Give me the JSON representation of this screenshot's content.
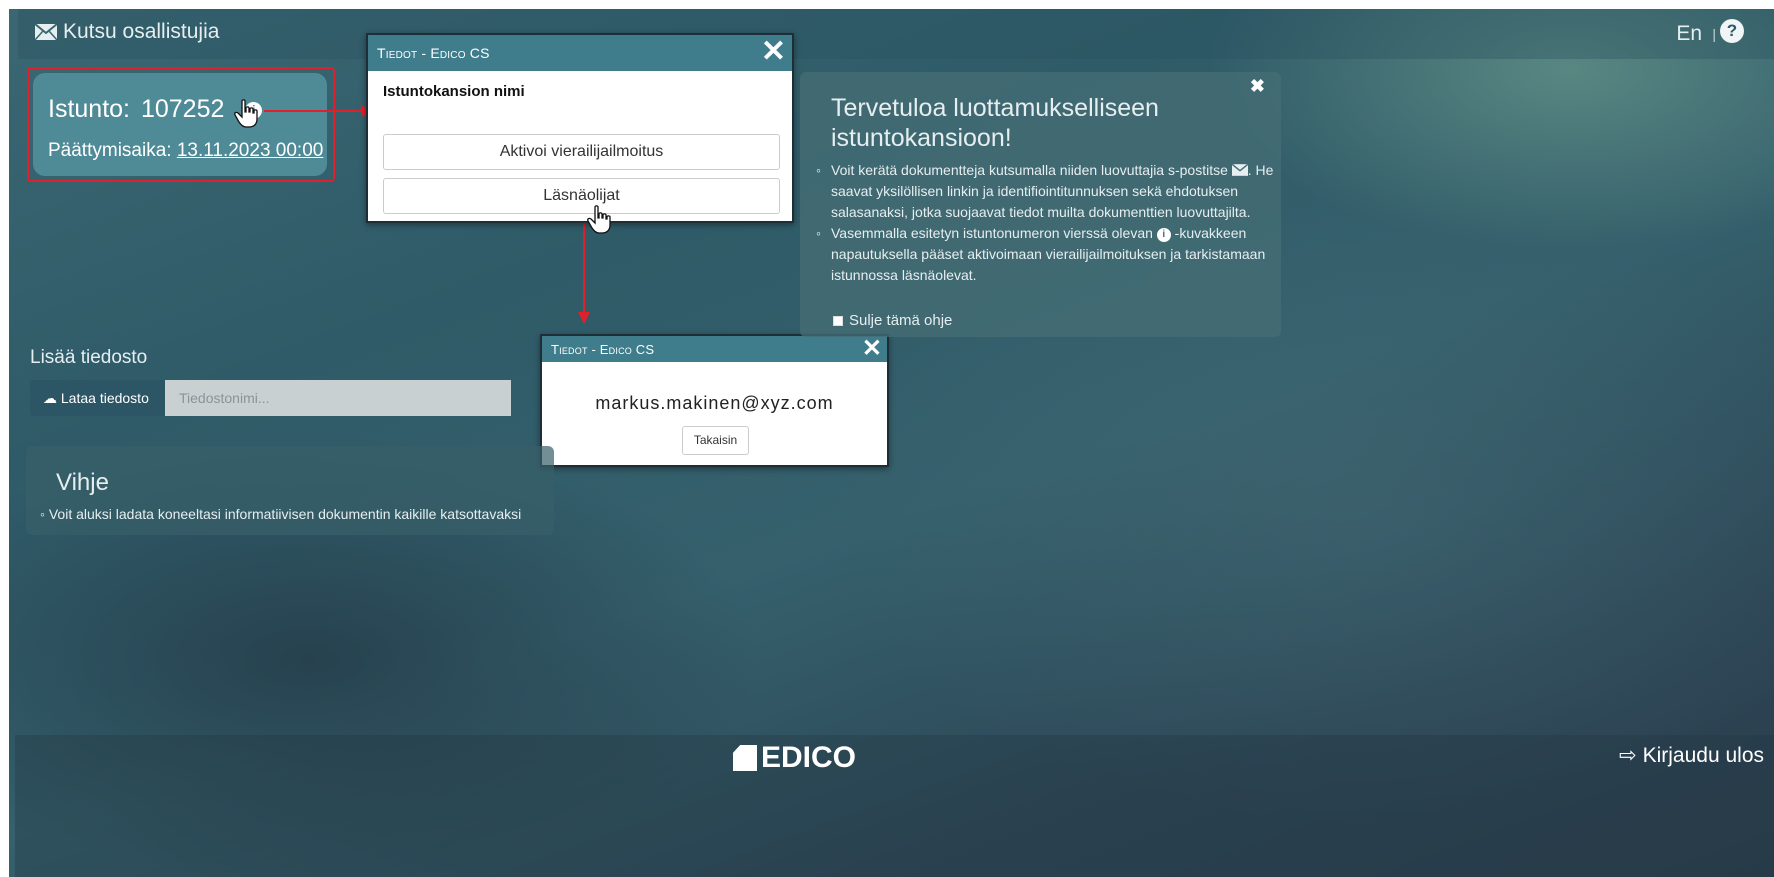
{
  "header": {
    "title": "Kutsu osallistujia",
    "language": "En",
    "separator": "|"
  },
  "session": {
    "label": "Istunto:",
    "number": "107252",
    "expiry_label": "Päättymisaika:",
    "expiry_date": "13.11.2023 00:00"
  },
  "dialog_info": {
    "title": "Tiedot - Edico CS",
    "folder_name_label": "Istuntokansion nimi",
    "activate_button": "Aktivoi vierailijailmoitus",
    "attendees_button": "Läsnäolijat"
  },
  "dialog_attendees": {
    "title": "Tiedot - Edico CS",
    "email": "markus.makinen@xyz.com",
    "back_button": "Takaisin"
  },
  "welcome": {
    "title": "Tervetuloa luottamukselliseen istuntokansioon!",
    "items": [
      {
        "before": "Voit kerätä dokumentteja kutsumalla niiden luovuttajia s-postitse ",
        "after": ". He saavat yksilöllisen linkin ja identifiointitunnuksen sekä ehdotuksen salasanaksi, jotka suojaavat tiedot muilta dokumenttien luovuttajilta."
      },
      {
        "before": "Vasemmalla esitetyn istuntonumeron vierssä olevan ",
        "after": " -kuvakkeen napautuksella pääset aktivoimaan vierailijailmoituksen ja tarkistamaan istunnossa läsnäolevat."
      }
    ],
    "close_guide_label": "Sulje tämä ohje"
  },
  "upload": {
    "section_label": "Lisää tiedosto",
    "button_label": "Lataa tiedosto",
    "placeholder": "Tiedostonimi..."
  },
  "hint": {
    "title": "Vihje",
    "text": "Voit aluksi ladata koneeltasi informatiivisen dokumentin kaikille katsottavaksi"
  },
  "footer": {
    "logo": "EDICO",
    "logout_label": "Kirjaudu ulos"
  },
  "colors": {
    "accent_red": "#e0202a",
    "dialog_header": "#3f7d8c",
    "session_card": "#4f8a97"
  }
}
